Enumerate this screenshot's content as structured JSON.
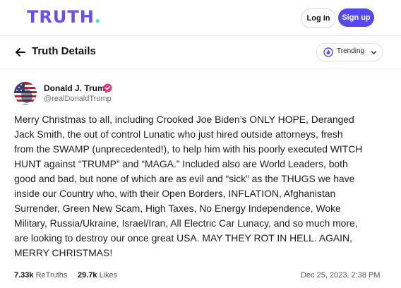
{
  "topbar": {
    "logo_text": "TRUTH",
    "logo_dot": ".",
    "login_label": "Log in",
    "signup_label": "Sign up"
  },
  "header": {
    "back_icon": "arrow-left-icon",
    "title": "Truth Details",
    "trending_icon": "flame-icon",
    "trending_label": "Trending",
    "trending_chevron": "chevron-down-icon"
  },
  "post": {
    "author_name": "Donald J. Trump",
    "verified_icon": "verified-badge-icon",
    "handle": "@realDonaldTrump",
    "lines": [
      "Merry Christmas to all, including Crooked Joe Biden’s ONLY HOPE, Deranged",
      "Jack Smith, the out of control Lunatic who just hired outside attorneys, fresh",
      "from the SWAMP (unprecedented!), to help him with his poorly executed WITCH",
      "HUNT against “TRUMP” and “MAGA.” Included also are World Leaders, both",
      "good and bad, but none of which are as evil and “sick” as the THUGS we have",
      "inside our Country who, with their Open Borders, INFLATION, Afghanistan",
      "Surrender, Green New Scam, High Taxes, No Energy Independence, Woke",
      "Military, Russia/Ukraine, Israel/Iran, All Electric Car Lunacy, and so much more,",
      "are looking to destroy our once great USA. MAY THEY ROT IN HELL. AGAIN,",
      "MERRY CHRISTMAS!"
    ],
    "retruths_count": "7.33k",
    "retruths_label": "ReTruths",
    "likes_count": "29.7k",
    "likes_label": "Likes",
    "timestamp": "Dec 25, 2023, 2:38 PM"
  },
  "colors": {
    "brand": "#6b4cf5",
    "accent": "#5448ee",
    "logo_dot": "#2ee6c9",
    "verified": "#e23a7a"
  }
}
